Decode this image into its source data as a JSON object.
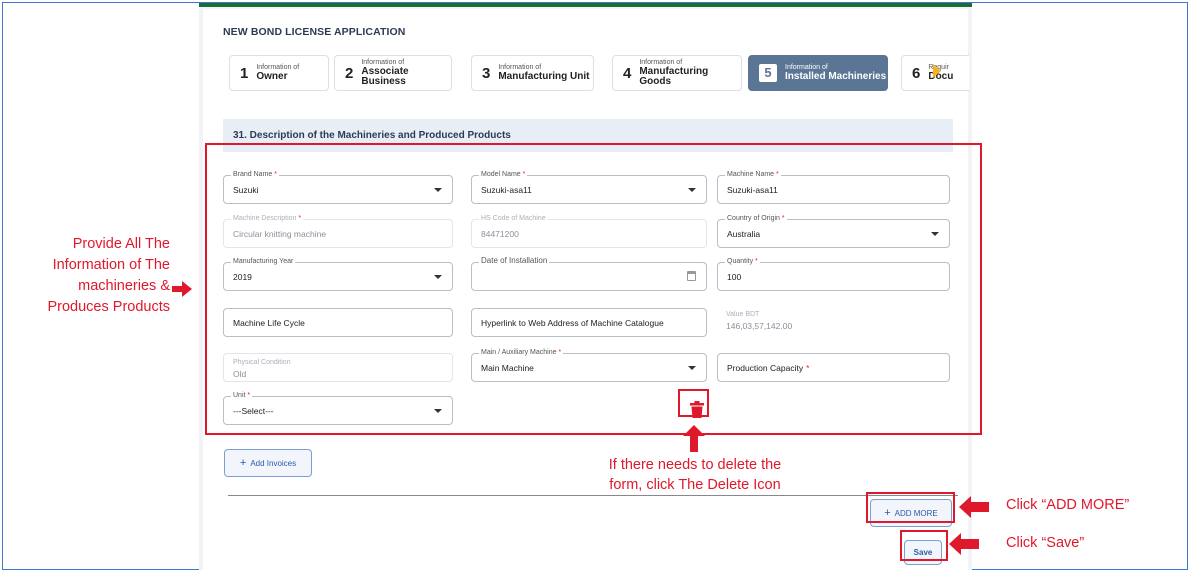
{
  "page": {
    "title": "NEW BOND LICENSE APPLICATION"
  },
  "steps": [
    {
      "num": "1",
      "sub": "Information of",
      "main": "Owner"
    },
    {
      "num": "2",
      "sub": "Information of",
      "main": "Associate Business"
    },
    {
      "num": "3",
      "sub": "Information of",
      "main": "Manufacturing Unit"
    },
    {
      "num": "4",
      "sub": "Information of",
      "main": "Manufacturing Goods"
    },
    {
      "num": "5",
      "sub": "Information of",
      "main": "Installed Machineries",
      "active": true
    },
    {
      "num": "6",
      "sub": "Requir",
      "main": "Docu"
    }
  ],
  "section": {
    "title": "31. Description of the Machineries and Produced Products"
  },
  "form": {
    "brand_name": {
      "label": "Brand Name",
      "value": "Suzuki"
    },
    "model_name": {
      "label": "Model Name",
      "value": "Suzuki-asa11"
    },
    "machine_name": {
      "label": "Machine Name",
      "value": "Suzuki-asa11"
    },
    "machine_description": {
      "label": "Machine Description",
      "value": "Circular knitting machine"
    },
    "hs_code": {
      "label": "HS Code of Machine",
      "value": "84471200"
    },
    "country_of_origin": {
      "label": "Country of Origin",
      "value": "Australia"
    },
    "manufacturing_year": {
      "label": "Manufacturing Year",
      "value": "2019"
    },
    "date_of_installation": {
      "label": "Date of Installation",
      "value": ""
    },
    "quantity": {
      "label": "Quantity",
      "value": "100"
    },
    "machine_life_cycle": {
      "placeholder": "Machine Life Cycle"
    },
    "hyperlink": {
      "placeholder": "Hyperlink to Web Address of Machine Catalogue"
    },
    "value_bdt": {
      "label": "Value BDT",
      "value": "146,03,57,142.00"
    },
    "physical_condition": {
      "label": "Physical Condition",
      "value": "Old"
    },
    "main_auxiliary": {
      "label": "Main / Auxiliary Machine",
      "value": "Main Machine"
    },
    "production_capacity": {
      "placeholder": "Production Capacity"
    },
    "unit": {
      "label": "Unit",
      "value": "---Select---"
    },
    "required_mark": "*"
  },
  "buttons": {
    "add_invoices": "Add Invoices",
    "add_more": "ADD MORE",
    "save": "Save",
    "plus": "+"
  },
  "annotations": {
    "left_note": [
      "Provide All The",
      "Information of The",
      "machineries &",
      "Produces Products"
    ],
    "delete_note": [
      "If there needs to delete the",
      "form, click The Delete Icon"
    ],
    "add_more_note": "Click “ADD MORE”",
    "save_note": "Click “Save”"
  },
  "colors": {
    "annotation_red": "#e0182c",
    "active_step": "#5b7594",
    "header_green": "#1e6b3a"
  }
}
